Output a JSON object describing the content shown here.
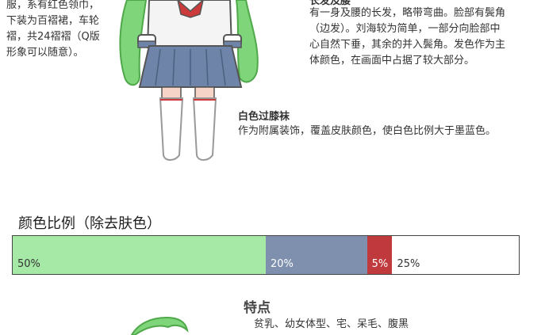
{
  "left_text": [
    "服，系有红色领巾，",
    "下装为百褶裙，车轮",
    "褶，共24褶褶（Q版",
    "形象可以随意）。"
  ],
  "hair": {
    "title": "长发及腰",
    "lines": [
      "有一身及腰的长发，略带弯曲。脸部有鬓角",
      "（边发）。刘海较为简单，一部分向脸部中",
      "心自然下垂，其余的并入鬓角。发色作为主",
      "体颜色，在画面中占据了较大部分。"
    ]
  },
  "socks": {
    "title": "白色过膝袜",
    "desc": "作为附属装饰，覆盖皮肤颜色，使白色比例大于墨蓝色。"
  },
  "ratio": {
    "title": "颜色比例（除去肤色）",
    "segments": [
      {
        "label": "50%",
        "value": 50,
        "color": "#a6e8a6",
        "text_color": "#333333"
      },
      {
        "label": "20%",
        "value": 20,
        "color": "#7e90ae",
        "text_color": "#ffffff"
      },
      {
        "label": "5%",
        "value": 5,
        "color": "#c0393c",
        "text_color": "#ffffff"
      },
      {
        "label": "25%",
        "value": 25,
        "color": "#ffffff",
        "text_color": "#333333"
      }
    ]
  },
  "traits": {
    "title": "特点",
    "desc": "贫乳、幼女体型、宅、呆毛、腹黑"
  },
  "colors": {
    "hair": "#7fd67a",
    "hair_dark": "#4fa84a",
    "skirt": "#6e84a8",
    "scarf": "#cc3b3b",
    "outline": "#555555"
  }
}
